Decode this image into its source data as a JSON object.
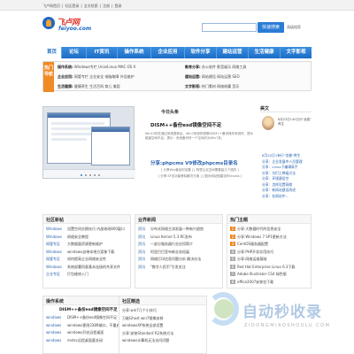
{
  "top_links": [
    "飞卢网首页",
    "社区登录",
    "全文检索",
    "注册",
    "登录"
  ],
  "logo": {
    "cn": "飞卢网",
    "en": "feiyoo.com"
  },
  "search": {
    "placeholder": "",
    "button": "快速搜索",
    "advanced": "高级搜索"
  },
  "nav": [
    "首页",
    "论坛",
    "IT资讯",
    "操作系统",
    "企业应用",
    "软件分享",
    "建站运营",
    "生活健康",
    "文字影视"
  ],
  "hot": {
    "tag": "热门导航",
    "rows": [
      {
        "label": "操作系统:",
        "items": "Windows专栏  Unix/Linux  MAC OS X",
        "label2": "教育分享:",
        "items2": "办公软件  影音娱乐  网络工具"
      },
      {
        "label": "企业应用:",
        "items": "网管专栏  企业安全  电脑故障  外设维护",
        "label2": "建站运营:",
        "items2": "网站建设  网站运营  SEO"
      },
      {
        "label": "生活健康:",
        "items": "健康养生  生活百科  育儿  美容",
        "label2": "文字影视:",
        "items2": "热门素材  网络收藏  音乐"
      }
    ]
  },
  "main": {
    "news_title": "今日头条",
    "headline": "DISM++备份esd镜像空间不足",
    "desc": "Win10的在通过系统更新后，Win7系统的镜像DISM++备份操作系统时，提示磁盘空间不足。提示：系统备份时一个空间约为Win7多。",
    "headline2": "分享:phpcms V9修改phpcms目录名",
    "sub1": "[ 分享Win最佳时设置 ]   [ 阿里云买空间需要装几个插件 ]",
    "sub2": "[ 分享:SF迅功能移除解决方案 ]   [ 图为网站做建设时vhosts ]",
    "fav_title": "美文",
    "fav_feature": "8月22日140日分\"龙猫\" 养生",
    "fav_list": [
      "8月22日1有行\"龙着\"养生",
      "分享：企业发展中人员管理",
      "分享：Linux下编辑高手",
      "分享：为们工降级方法",
      "分享：环境建设空",
      "分享：怎样设置网络",
      "分享：新网站建设改进",
      "分享：在网站中..."
    ]
  },
  "panels": {
    "community": {
      "title": "社区新帖",
      "rows": [
        {
          "cat": "Windows",
          "text": "设置空间交换技巧 内部修改800窗口"
        },
        {
          "cat": "Windows",
          "text": "网络安全教程"
        },
        {
          "cat": "网管专区",
          "text": "大数据量资源更新维护"
        },
        {
          "cat": "Windows",
          "text": "windows自带本地方案移下载"
        },
        {
          "cat": "网管专区",
          "text": "如何提高企业网络安全性"
        },
        {
          "cat": "Windows",
          "text": "系统部署同意基本连接的共享文件"
        },
        {
          "cat": "企业专区",
          "text": "打包维修入门"
        }
      ]
    },
    "business": {
      "title": "业界新闻",
      "rows": [
        {
          "cat": "资讯",
          "text": "分布式网络主流发展一种新兴趋势"
        },
        {
          "cat": "资讯",
          "text": "Linux Kernel 5.3 RC发布"
        },
        {
          "cat": "资讯",
          "text": "一部分服务器行业应用简介"
        },
        {
          "cat": "资讯",
          "text": "阿里巴巴宣布新业务拓展"
        },
        {
          "cat": "资讯",
          "text": "网络打印信息问题分析 解决办法"
        },
        {
          "cat": "资讯",
          "text": "\"数字人民币\"引发关注"
        }
      ]
    },
    "hot_tags": {
      "title": "热门主题",
      "rows": [
        "分享:大数据时代的信息安全",
        "分享:Windows 7 SP1更新方法",
        "CentOS服务器配置",
        "分享:PHP开发实用技巧",
        "分享:网络运维基础",
        "Red Hat Enterprise Linux 6.3下载",
        "Adobe Illustrator CS4 绿色版",
        "office2007安装包下载"
      ]
    },
    "os": {
      "title": "操作系统",
      "feature": "DISM++备份esd镜像空间不足",
      "rows": [
        {
          "cat": "windows",
          "text": "DISM++备份esd镜像空间不足"
        },
        {
          "cat": "windows",
          "text": "windows更改3389端口，不重启生效"
        },
        {
          "cat": "windows",
          "text": "windows开启远程桌面"
        },
        {
          "cat": "windows",
          "text": "mstsc远程桌面要关闭"
        }
      ]
    },
    "community2": {
      "title": "社区精选",
      "rows": [
        {
          "cat": "",
          "text": "分享:win7几个小技巧"
        },
        {
          "cat": "",
          "text": "万能Ghost win7镜像安装"
        },
        {
          "cat": "",
          "text": "windowsXP系统全部设置"
        },
        {
          "cat": "",
          "text": "分享:安装Standard R2系统方法"
        },
        {
          "cat": "",
          "text": "windows计算机无法访问问题"
        }
      ]
    }
  },
  "watermark": {
    "big": "自动秒收录",
    "small": "ZIDONGMIAOSHOULU.COM"
  }
}
